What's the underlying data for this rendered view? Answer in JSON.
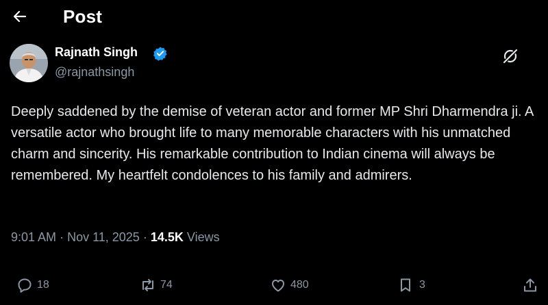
{
  "header": {
    "title": "Post",
    "back_icon": "arrow-left-icon"
  },
  "author": {
    "name": "Rajnath Singh",
    "handle": "@rajnathsingh",
    "verified": true,
    "verified_color": "#1d9bf0",
    "avatar_icon": "profile-photo"
  },
  "post": {
    "text": "Deeply saddened by the demise of veteran actor and former MP Shri Dharmendra ji. A versatile actor who brought life to many memorable characters with his unmatched charm and sincerity. His remarkable contribution to Indian cinema will always be remembered. My heartfelt condolences to his family and admirers.",
    "time": "9:01 AM",
    "date": "Nov 11, 2025",
    "separator": "·",
    "views_count": "14.5K",
    "views_label": "Views"
  },
  "actions": {
    "replies": "18",
    "reposts": "74",
    "likes": "480",
    "bookmarks": "3"
  },
  "colors": {
    "background": "#000000",
    "text": "#e7e9ea",
    "secondary_text": "#8b98a5",
    "icon": "#8b98a5"
  }
}
